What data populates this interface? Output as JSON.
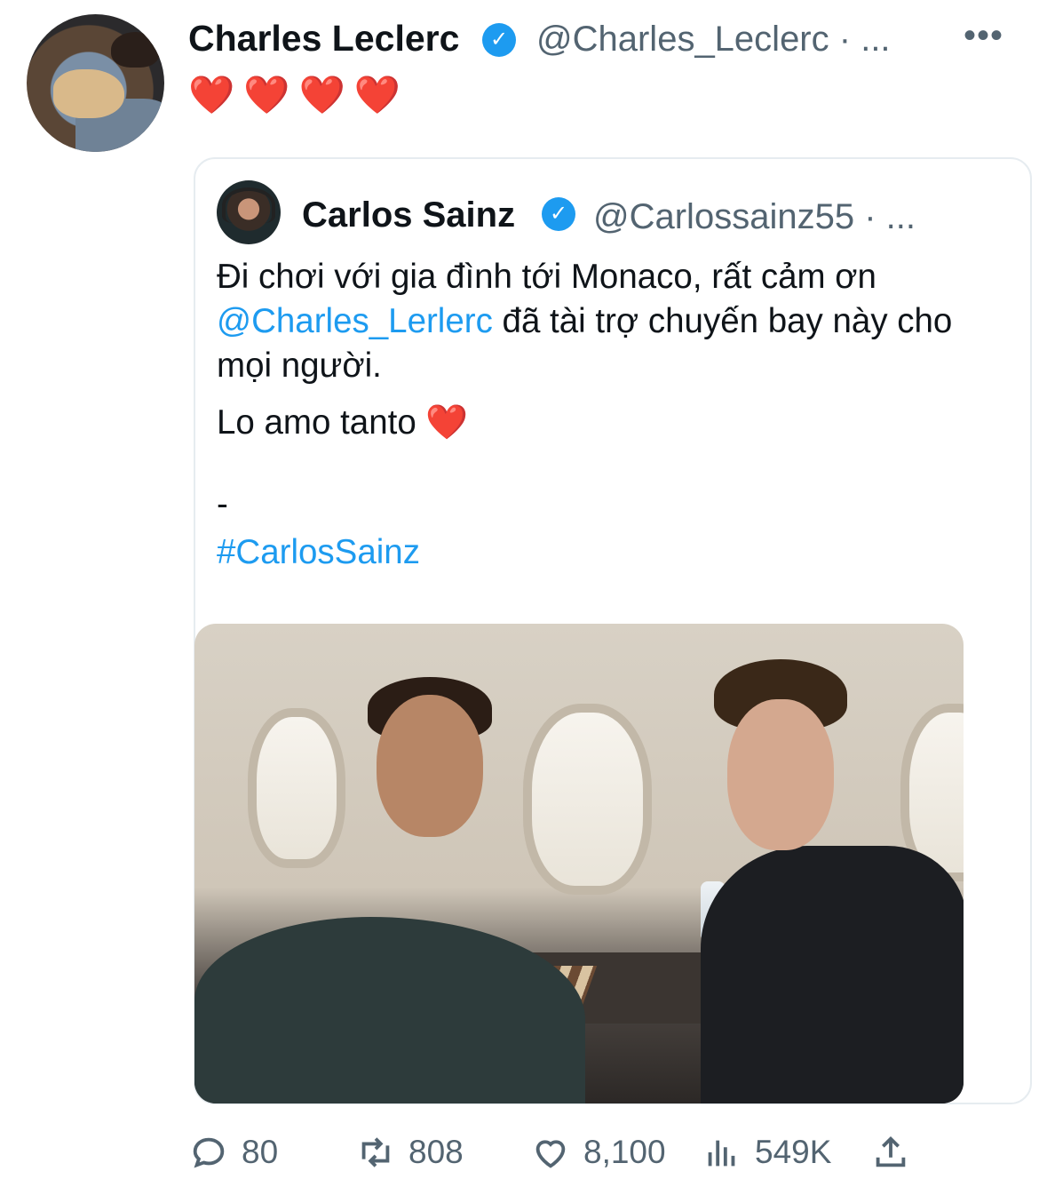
{
  "tweet": {
    "author_name": "Charles Leclerc",
    "author_handle": "@Charles_Leclerc",
    "time_separator": "· ...",
    "more_icon": "•••",
    "verified_mark": "✓",
    "text": "❤️❤️❤️❤️"
  },
  "quote": {
    "author_name": "Carlos Sainz",
    "author_handle": "@Carlossainz55",
    "time_separator": "· ...",
    "verified_mark": "✓",
    "line1_before": "Đi chơi với gia đình tới Monaco, rất cảm ơn ",
    "mention": "@Charles_Lerlerc",
    "line1_after": " đã tài trợ chuyến bay này cho mọi người.",
    "line2": "Lo amo tanto ❤️",
    "dash": "-",
    "hashtag": "#CarlosSainz"
  },
  "actions": {
    "replies": "80",
    "retweets": "808",
    "likes": "8,100",
    "views": "549K"
  },
  "colors": {
    "link": "#1d9bf0",
    "muted": "#536471",
    "heart": "#e0245e"
  }
}
